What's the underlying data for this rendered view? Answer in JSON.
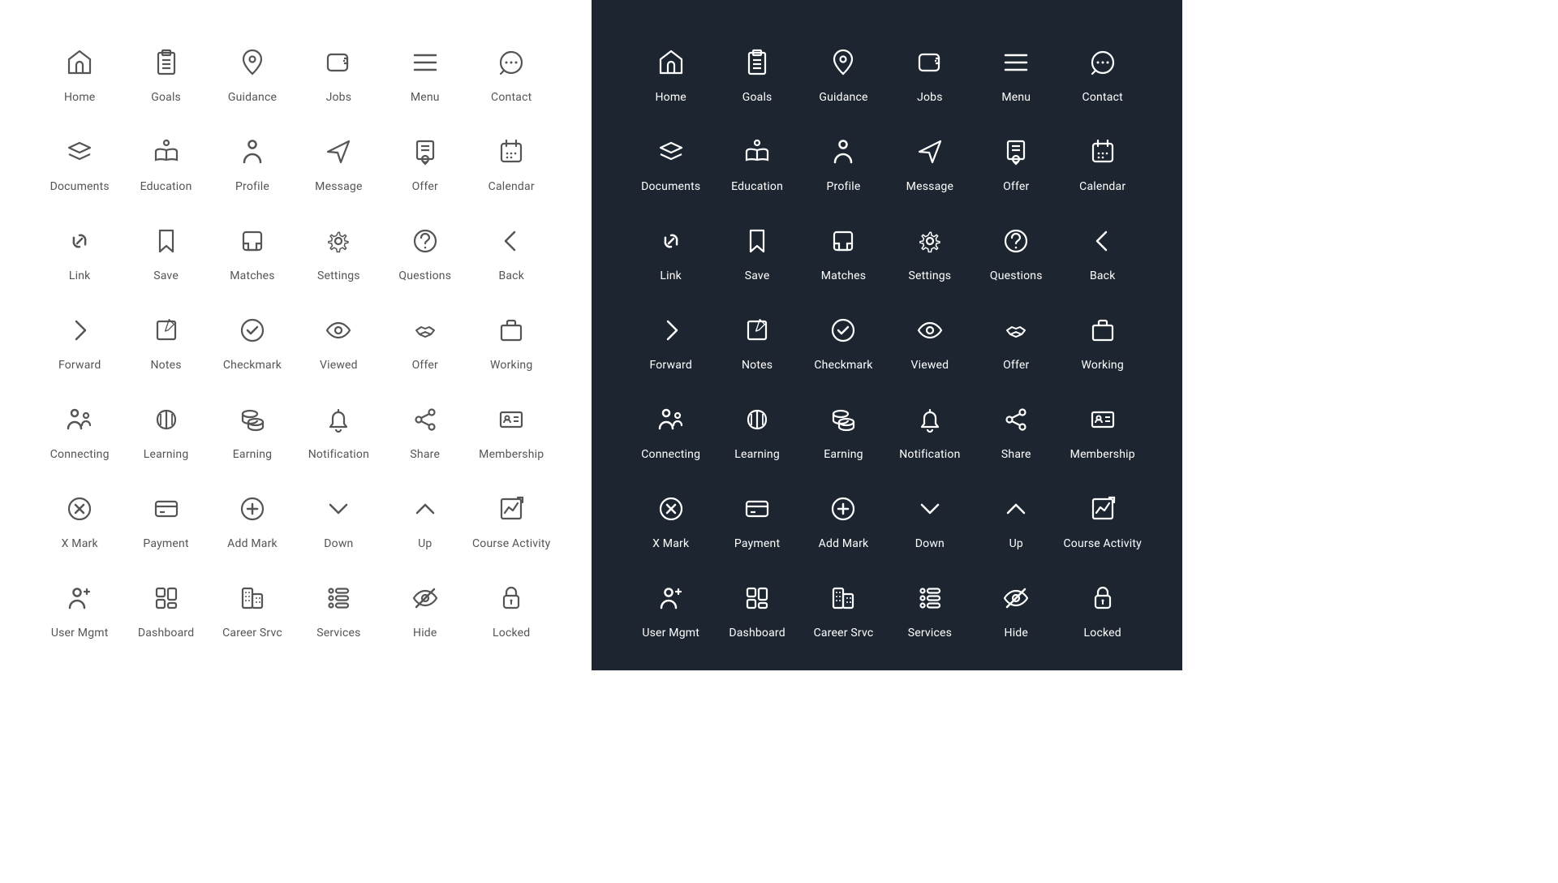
{
  "panels": [
    "light",
    "dark"
  ],
  "light_color": "#555555",
  "dark_bg": "#1c2530",
  "dark_color": "#ffffff",
  "icons": [
    {
      "name": "home-icon",
      "label": "Home"
    },
    {
      "name": "goals-icon",
      "label": "Goals"
    },
    {
      "name": "guidance-icon",
      "label": "Guidance"
    },
    {
      "name": "jobs-icon",
      "label": "Jobs"
    },
    {
      "name": "menu-icon",
      "label": "Menu"
    },
    {
      "name": "contact-icon",
      "label": "Contact"
    },
    {
      "name": "documents-icon",
      "label": "Documents"
    },
    {
      "name": "education-icon",
      "label": "Education"
    },
    {
      "name": "profile-icon",
      "label": "Profile"
    },
    {
      "name": "message-icon",
      "label": "Message"
    },
    {
      "name": "offer-icon",
      "label": "Offer"
    },
    {
      "name": "calendar-icon",
      "label": "Calendar"
    },
    {
      "name": "link-icon",
      "label": "Link"
    },
    {
      "name": "save-icon",
      "label": "Save"
    },
    {
      "name": "matches-icon",
      "label": "Matches"
    },
    {
      "name": "settings-icon",
      "label": "Settings"
    },
    {
      "name": "questions-icon",
      "label": "Questions"
    },
    {
      "name": "back-icon",
      "label": "Back"
    },
    {
      "name": "forward-icon",
      "label": "Forward"
    },
    {
      "name": "notes-icon",
      "label": "Notes"
    },
    {
      "name": "checkmark-icon",
      "label": "Checkmark"
    },
    {
      "name": "viewed-icon",
      "label": "Viewed"
    },
    {
      "name": "offer2-icon",
      "label": "Offer"
    },
    {
      "name": "working-icon",
      "label": "Working"
    },
    {
      "name": "connecting-icon",
      "label": "Connecting"
    },
    {
      "name": "learning-icon",
      "label": "Learning"
    },
    {
      "name": "earning-icon",
      "label": "Earning"
    },
    {
      "name": "notification-icon",
      "label": "Notification"
    },
    {
      "name": "share-icon",
      "label": "Share"
    },
    {
      "name": "membership-icon",
      "label": "Membership"
    },
    {
      "name": "xmark-icon",
      "label": "X Mark"
    },
    {
      "name": "payment-icon",
      "label": "Payment"
    },
    {
      "name": "addmark-icon",
      "label": "Add Mark"
    },
    {
      "name": "down-icon",
      "label": "Down"
    },
    {
      "name": "up-icon",
      "label": "Up"
    },
    {
      "name": "courseactivity-icon",
      "label": "Course Activity"
    },
    {
      "name": "usermgmt-icon",
      "label": "User Mgmt"
    },
    {
      "name": "dashboard-icon",
      "label": "Dashboard"
    },
    {
      "name": "careersrvc-icon",
      "label": "Career Srvc"
    },
    {
      "name": "services-icon",
      "label": "Services"
    },
    {
      "name": "hide-icon",
      "label": "Hide"
    },
    {
      "name": "locked-icon",
      "label": "Locked"
    }
  ]
}
